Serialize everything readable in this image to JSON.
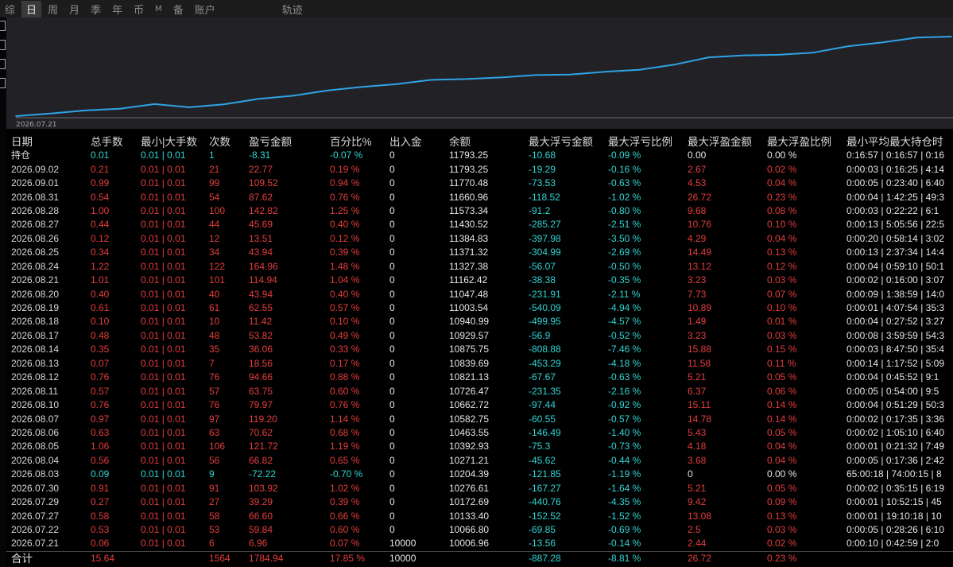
{
  "tabs": [
    "综",
    "日",
    "周",
    "月",
    "季",
    "年",
    "币",
    "M",
    "备",
    "账户",
    "轨迹"
  ],
  "active_tab": "日",
  "chart_data": {
    "type": "line",
    "x": [
      "2026-07-21",
      "2026-07-22",
      "2026-07-27",
      "2026-07-29",
      "2026-07-30",
      "2026-08-03",
      "2026-08-04",
      "2026-08-05",
      "2026-08-06",
      "2026-08-07",
      "2026-08-10",
      "2026-08-11",
      "2026-08-12",
      "2026-08-13",
      "2026-08-14",
      "2026-08-17",
      "2026-08-18",
      "2026-08-19",
      "2026-08-20",
      "2026-08-21",
      "2026-08-24",
      "2026-08-25",
      "2026-08-26",
      "2026-08-27",
      "2026-08-28",
      "2026-08-31",
      "2026-09-01",
      "2026-09-02"
    ],
    "y": [
      10006.96,
      10066.8,
      10133.4,
      10172.69,
      10276.61,
      10204.39,
      10271.21,
      10392.93,
      10463.55,
      10582.75,
      10662.72,
      10726.47,
      10821.13,
      10839.69,
      10875.75,
      10929.57,
      10940.99,
      11003.54,
      11047.48,
      11162.42,
      11327.38,
      11371.32,
      11384.83,
      11430.52,
      11573.34,
      11660.96,
      11770.48,
      11793.25
    ],
    "x_tick_label": "2026.07.21",
    "color": "#2fa3e6"
  },
  "columns": [
    "日期",
    "总手数",
    "最小|大手数",
    "次数",
    "盈亏金额",
    "百分比%",
    "出入金",
    "余额",
    "最大浮亏金额",
    "最大浮亏比例",
    "最大浮盈金额",
    "最大浮盈比例",
    "最小平均最大持仓时"
  ],
  "holding_row": [
    "持仓",
    "0.01",
    "0.01 | 0.01",
    "1",
    "-8.31",
    "-0.07 %",
    "0",
    "11793.25",
    "-10.68",
    "-0.09 %",
    "0.00",
    "0.00 %",
    "0:16:57 | 0:16:57 | 0:16"
  ],
  "rows": [
    [
      "2026.09.02",
      "0.21",
      "0.01 | 0.01",
      "21",
      "22.77",
      "0.19 %",
      "0",
      "11793.25",
      "-19.29",
      "-0.16 %",
      "2.67",
      "0.02 %",
      "0:00:03 | 0:16:25 | 4:14"
    ],
    [
      "2026.09.01",
      "0.99",
      "0.01 | 0.01",
      "99",
      "109.52",
      "0.94 %",
      "0",
      "11770.48",
      "-73.53",
      "-0.63 %",
      "4.53",
      "0.04 %",
      "0:00:05 | 0:23:40 | 6:40"
    ],
    [
      "2026.08.31",
      "0.54",
      "0.01 | 0.01",
      "54",
      "87.62",
      "0.76 %",
      "0",
      "11660.96",
      "-118.52",
      "-1.02 %",
      "26.72",
      "0.23 %",
      "0:00:04 | 1:42:25 | 49:3"
    ],
    [
      "2026.08.28",
      "1.00",
      "0.01 | 0.01",
      "100",
      "142.82",
      "1.25 %",
      "0",
      "11573.34",
      "-91.2",
      "-0.80 %",
      "9.68",
      "0.08 %",
      "0:00:03 | 0:22:22 | 6:1"
    ],
    [
      "2026.08.27",
      "0.44",
      "0.01 | 0.01",
      "44",
      "45.69",
      "0.40 %",
      "0",
      "11430.52",
      "-285.27",
      "-2.51 %",
      "10.76",
      "0.10 %",
      "0:00:13 | 5:05:56 | 22:5"
    ],
    [
      "2026.08.26",
      "0.12",
      "0.01 | 0.01",
      "12",
      "13.51",
      "0.12 %",
      "0",
      "11384.83",
      "-397.98",
      "-3.50 %",
      "4.29",
      "0.04 %",
      "0:00:20 | 0:58:14 | 3:02"
    ],
    [
      "2026.08.25",
      "0.34",
      "0.01 | 0.01",
      "34",
      "43.94",
      "0.39 %",
      "0",
      "11371.32",
      "-304.99",
      "-2.69 %",
      "14.49",
      "0.13 %",
      "0:00:13 | 2:37:34 | 14:4"
    ],
    [
      "2026.08.24",
      "1.22",
      "0.01 | 0.01",
      "122",
      "164.96",
      "1.48 %",
      "0",
      "11327.38",
      "-56.07",
      "-0.50 %",
      "13.12",
      "0.12 %",
      "0:00:04 | 0:59:10 | 50:1"
    ],
    [
      "2026.08.21",
      "1.01",
      "0.01 | 0.01",
      "101",
      "114.94",
      "1.04 %",
      "0",
      "11162.42",
      "-38.38",
      "-0.35 %",
      "3.23",
      "0.03 %",
      "0:00:02 | 0:16:00 | 3:07"
    ],
    [
      "2026.08.20",
      "0.40",
      "0.01 | 0.01",
      "40",
      "43.94",
      "0.40 %",
      "0",
      "11047.48",
      "-231.91",
      "-2.11 %",
      "7.73",
      "0.07 %",
      "0:00:09 | 1:38:59 | 14:0"
    ],
    [
      "2026.08.19",
      "0.61",
      "0.01 | 0.01",
      "61",
      "62.55",
      "0.57 %",
      "0",
      "11003.54",
      "-540.09",
      "-4.94 %",
      "10.89",
      "0.10 %",
      "0:00:01 | 4:07:54 | 35:3"
    ],
    [
      "2026.08.18",
      "0.10",
      "0.01 | 0.01",
      "10",
      "11.42",
      "0.10 %",
      "0",
      "10940.99",
      "-499.95",
      "-4.57 %",
      "1.49",
      "0.01 %",
      "0:00:04 | 0:27:52 | 3:27"
    ],
    [
      "2026.08.17",
      "0.48",
      "0.01 | 0.01",
      "48",
      "53.82",
      "0.49 %",
      "0",
      "10929.57",
      "-56.9",
      "-0.52 %",
      "3.23",
      "0.03 %",
      "0:00:08 | 3:59:59 | 54:3"
    ],
    [
      "2026.08.14",
      "0.35",
      "0.01 | 0.01",
      "35",
      "36.06",
      "0.33 %",
      "0",
      "10875.75",
      "-808.88",
      "-7.46 %",
      "15.88",
      "0.15 %",
      "0:00:03 | 8:47:50 | 35:4"
    ],
    [
      "2026.08.13",
      "0.07",
      "0.01 | 0.01",
      "7",
      "18.56",
      "0.17 %",
      "0",
      "10839.69",
      "-453.29",
      "-4.18 %",
      "11.58",
      "0.11 %",
      "0:00:14 | 1:17:52 | 5:09"
    ],
    [
      "2026.08.12",
      "0.76",
      "0.01 | 0.01",
      "76",
      "94.66",
      "0.88 %",
      "0",
      "10821.13",
      "-67.67",
      "-0.63 %",
      "5.21",
      "0.05 %",
      "0:00:04 | 0:45:52 | 9:1"
    ],
    [
      "2026.08.11",
      "0.57",
      "0.01 | 0.01",
      "57",
      "63.75",
      "0.60 %",
      "0",
      "10726.47",
      "-231.35",
      "-2.16 %",
      "6.37",
      "0.06 %",
      "0:00:05 | 0:54:00 | 9:5"
    ],
    [
      "2026.08.10",
      "0.76",
      "0.01 | 0.01",
      "76",
      "79.97",
      "0.76 %",
      "0",
      "10662.72",
      "-97.44",
      "-0.92 %",
      "15.11",
      "0.14 %",
      "0:00:04 | 0:51:29 | 50:3"
    ],
    [
      "2026.08.07",
      "0.97",
      "0.01 | 0.01",
      "97",
      "119.20",
      "1.14 %",
      "0",
      "10582.75",
      "-60.55",
      "-0.57 %",
      "14.78",
      "0.14 %",
      "0:00:02 | 0:17:35 | 3:36"
    ],
    [
      "2026.08.06",
      "0.63",
      "0.01 | 0.01",
      "63",
      "70.62",
      "0.68 %",
      "0",
      "10463.55",
      "-146.49",
      "-1.40 %",
      "5.43",
      "0.05 %",
      "0:00:02 | 1:05:10 | 6:40"
    ],
    [
      "2026.08.05",
      "1.06",
      "0.01 | 0.01",
      "106",
      "121.72",
      "1.19 %",
      "0",
      "10392.93",
      "-75.3",
      "-0.73 %",
      "4.18",
      "0.04 %",
      "0:00:01 | 0:21:32 | 7:49"
    ],
    [
      "2026.08.04",
      "0.56",
      "0.01 | 0.01",
      "56",
      "66.82",
      "0.65 %",
      "0",
      "10271.21",
      "-45.62",
      "-0.44 %",
      "3.68",
      "0.04 %",
      "0:00:05 | 0:17:36 | 2:42"
    ],
    [
      "2026.08.03",
      "0.09",
      "0.01 | 0.01",
      "9",
      "-72.22",
      "-0.70 %",
      "0",
      "10204.39",
      "-121.85",
      "-1.19 %",
      "0",
      "0.00 %",
      "65:00:18 | 74:00:15 | 8"
    ],
    [
      "2026.07.30",
      "0.91",
      "0.01 | 0.01",
      "91",
      "103.92",
      "1.02 %",
      "0",
      "10276.61",
      "-167.27",
      "-1.64 %",
      "5.21",
      "0.05 %",
      "0:00:02 | 0:35:15 | 6:19"
    ],
    [
      "2026.07.29",
      "0.27",
      "0.01 | 0.01",
      "27",
      "39.29",
      "0.39 %",
      "0",
      "10172.69",
      "-440.76",
      "-4.35 %",
      "9.42",
      "0.09 %",
      "0:00:01 | 10:52:15 | 45"
    ],
    [
      "2026.07.27",
      "0.58",
      "0.01 | 0.01",
      "58",
      "66.60",
      "0.66 %",
      "0",
      "10133.40",
      "-152.52",
      "-1.52 %",
      "13.08",
      "0.13 %",
      "0:00:01 | 19:10:18 | 10"
    ],
    [
      "2026.07.22",
      "0.53",
      "0.01 | 0.01",
      "53",
      "59.84",
      "0.60 %",
      "0",
      "10066.80",
      "-69.85",
      "-0.69 %",
      "2.5",
      "0.03 %",
      "0:00:05 | 0:28:26 | 6:10"
    ],
    [
      "2026.07.21",
      "0.06",
      "0.01 | 0.01",
      "6",
      "6.96",
      "0.07 %",
      "10000",
      "10006.96",
      "-13.56",
      "-0.14 %",
      "2.44",
      "0.02 %",
      "0:00:10 | 0:42:59 | 2:0"
    ]
  ],
  "total_row": [
    "合计",
    "15.64",
    "",
    "1564",
    "1784.94",
    "17.85 %",
    "10000",
    "",
    "-887.28",
    "-8.81 %",
    "26.72",
    "0.23 %",
    ""
  ]
}
